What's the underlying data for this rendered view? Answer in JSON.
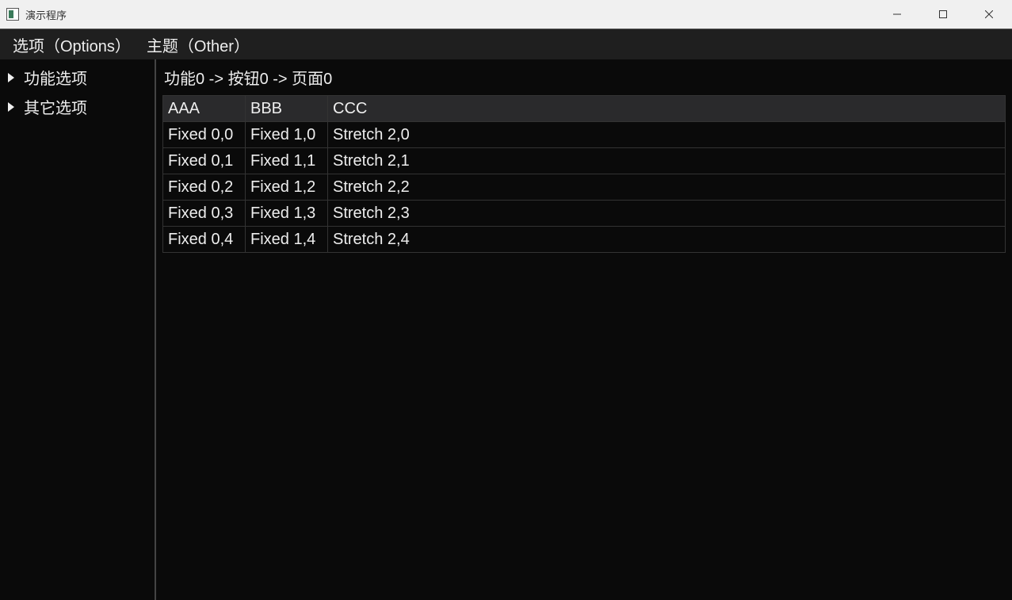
{
  "window": {
    "title": "演示程序"
  },
  "menubar": {
    "options_label": "选项（Options）",
    "theme_label": "主题（Other）"
  },
  "sidebar": {
    "items": [
      {
        "label": "功能选项"
      },
      {
        "label": "其它选项"
      }
    ]
  },
  "main": {
    "breadcrumb": "功能0 -> 按钮0 -> 页面0",
    "table": {
      "headers": [
        "AAA",
        "BBB",
        "CCC"
      ],
      "rows": [
        [
          "Fixed 0,0",
          "Fixed 1,0",
          "Stretch 2,0"
        ],
        [
          "Fixed 0,1",
          "Fixed 1,1",
          "Stretch 2,1"
        ],
        [
          "Fixed 0,2",
          "Fixed 1,2",
          "Stretch 2,2"
        ],
        [
          "Fixed 0,3",
          "Fixed 1,3",
          "Stretch 2,3"
        ],
        [
          "Fixed 0,4",
          "Fixed 1,4",
          "Stretch 2,4"
        ]
      ]
    }
  }
}
